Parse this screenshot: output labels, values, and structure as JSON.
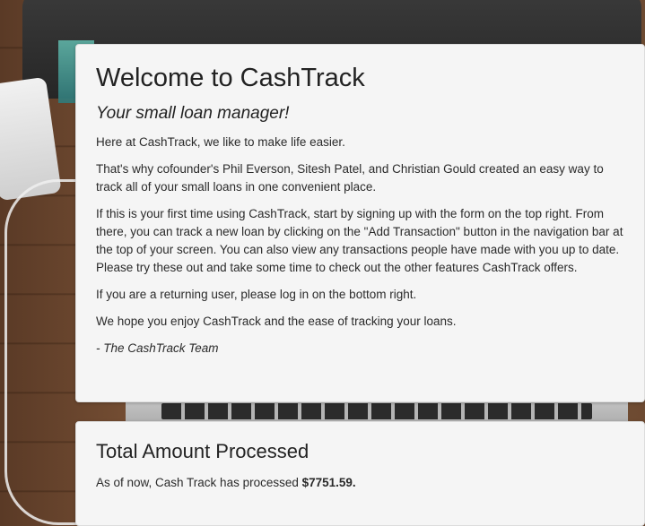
{
  "welcome": {
    "title": "Welcome to CashTrack",
    "subtitle": "Your small loan manager!",
    "paragraphs": [
      "Here at CashTrack, we like to make life easier.",
      "That's why cofounder's Phil Everson, Sitesh Patel, and Christian Gould created an easy way to track all of your small loans in one convenient place.",
      "If this is your first time using CashTrack, start by signing up with the form on the top right. From there, you can track a new loan by clicking on the \"Add Transaction\" button in the navigation bar at the top of your screen. You can also view any transactions people have made with you up to date. Please try these out and take some time to check out the other features CashTrack offers.",
      "If you are a returning user, please log in on the bottom right.",
      "We hope you enjoy CashTrack and the ease of tracking your loans."
    ],
    "signoff": "- The CashTrack Team"
  },
  "total": {
    "title": "Total Amount Processed",
    "text_prefix": "As of now, Cash Track has processed ",
    "amount": "$7751.59."
  }
}
